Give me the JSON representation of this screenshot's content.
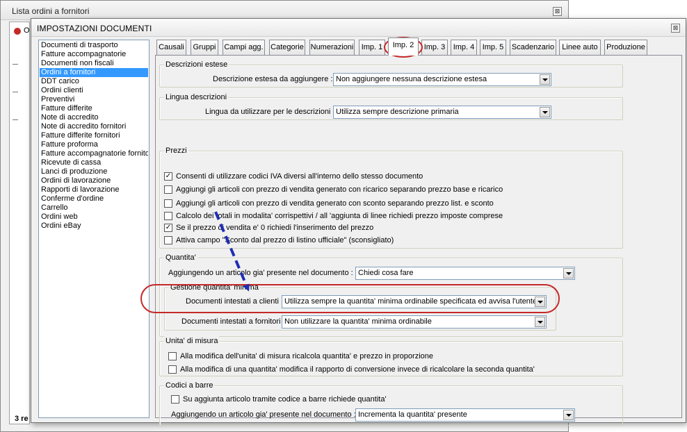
{
  "background_window": {
    "title": "Lista ordini a fornitori",
    "close_glyph": "⊠",
    "fragment_o": "O",
    "status_fragment": "3 re"
  },
  "dialog": {
    "title": "IMPOSTAZIONI DOCUMENTI",
    "close_glyph": "⊠"
  },
  "document_types": {
    "items": [
      "Documenti di trasporto",
      "Fatture accompagnatorie",
      "Documenti non fiscali",
      "Ordini a fornitori",
      "DDT carico",
      "Ordini clienti",
      "Preventivi",
      "Fatture differite",
      "Note di accredito",
      "Note di accredito fornitori",
      "Fatture differite fornitori",
      "Fatture proforma",
      "Fatture accompagnatorie fornitori",
      "Ricevute di cassa",
      "Lanci di produzione",
      "Ordini di lavorazione",
      "Rapporti di lavorazione",
      "Conferme d'ordine",
      "Carrello",
      "Ordini web",
      "Ordini eBay"
    ],
    "selected": "Ordini a fornitori"
  },
  "tabs": {
    "items": [
      "Causali",
      "Gruppi",
      "Campi agg.",
      "Categorie",
      "Numerazioni",
      "Imp. 1",
      "Imp. 2",
      "Imp. 3",
      "Imp. 4",
      "Imp. 5",
      "Scadenzario",
      "Linee auto",
      "Produzione"
    ],
    "active": "Imp. 2"
  },
  "descrizioni_estese": {
    "title": "Descrizioni estese",
    "label": "Descrizione estesa da aggiungere :",
    "value": "Non aggiungere nessuna descrizione estesa"
  },
  "lingua_descrizioni": {
    "title": "Lingua descrizioni",
    "label": "Lingua da utilizzare per le descrizioni :",
    "value": "Utilizza sempre descrizione primaria"
  },
  "prezzi": {
    "title": "Prezzi",
    "options": [
      {
        "label": "Consenti di utilizzare codici IVA diversi all'interno dello stesso documento",
        "checked": true
      },
      {
        "label": "Aggiungi gli articoli con prezzo di vendita generato con ricarico separando prezzo base e ricarico",
        "checked": false
      },
      {
        "label": "Aggiungi gli articoli con prezzo di vendita generato con sconto separando prezzo list. e sconto",
        "checked": false
      },
      {
        "label": "Calcolo dei totali in modalita' corrispettivi / all 'aggiunta di linee richiedi prezzo imposte comprese",
        "checked": false
      },
      {
        "label": "Se il prezzo di vendita e' 0 richiedi l'inserimento del prezzo",
        "checked": true
      },
      {
        "label": "Attiva campo \"Sconto dal prezzo di listino ufficiale\" (sconsigliato)",
        "checked": false
      }
    ]
  },
  "quantita": {
    "title": "Quantita'",
    "label": "Aggiungendo un articolo gia' presente nel documento :",
    "value": "Chiedi cosa fare",
    "gestione": {
      "title": "Gestione quantita' minima",
      "clienti_label": "Documenti intestati a clienti :",
      "clienti_value": "Utilizza sempre la quantita' minima ordinabile specificata ed avvisa l'utente",
      "fornitori_label": "Documenti intestati a fornitori :",
      "fornitori_value": "Non utilizzare la quantita' minima ordinabile"
    }
  },
  "unita_misura": {
    "title": "Unita' di misura",
    "options": [
      {
        "label": "Alla modifica dell'unita' di misura ricalcola quantita' e prezzo in proporzione",
        "checked": false
      },
      {
        "label": "Alla modifica di una quantita' modifica il rapporto di conversione invece di ricalcolare la seconda quantita'",
        "checked": false
      }
    ]
  },
  "codici_barre": {
    "title": "Codici a barre",
    "option": {
      "label": "Su aggiunta articolo tramite codice a barre richiede quantita'",
      "checked": false
    },
    "label": "Aggiungendo un articolo gia' presente nel documento :",
    "value": "Incrementa la quantita' presente"
  },
  "check_glyph": "✓",
  "colors": {
    "selection": "#3399ff",
    "annotation_red": "#c62828",
    "annotation_arrow": "#1f2db5"
  }
}
